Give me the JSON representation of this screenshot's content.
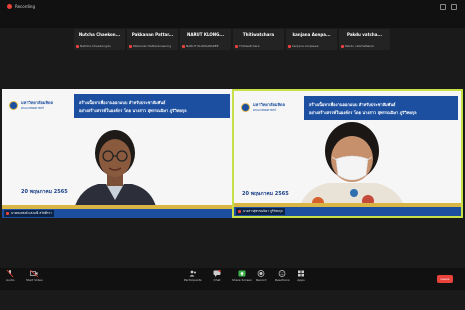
{
  "window": {
    "recording_label": "Recording"
  },
  "participants": [
    {
      "name": "Nutcha Chaekon...",
      "sub": "NatCha Chaekongdo"
    },
    {
      "name": "Pakkanan Pattar...",
      "sub": "Pakkanan Pattaranawong"
    },
    {
      "name": "NARUT KLONG...",
      "sub": "NARUT KLONGWAREE"
    },
    {
      "name": "Thitiwatchara",
      "sub": "Thitiwatchara"
    },
    {
      "name": "kanjana Aonpa...",
      "sub": "kanjana Aonpaew"
    },
    {
      "name": "Pakdu vatcha...",
      "sub": "Pakdu vatchaNakal"
    }
  ],
  "slide": {
    "university": "มหาวิทยาลัยมหิดล",
    "faculty": "คณะแพทยศาสตร์",
    "title_line1": "สร้างเนื้อหาเพื่องานออกแบบ สำหรับประชาสัมพันธ์",
    "title_line2": "อย่างสร้างสรรค์ในองค์กร โดย นางสาว สุพรรณนิษา ภูริวิทยกุล",
    "date": "20 พฤษภาคม 2565"
  },
  "tiles": [
    {
      "name": "นายกมลพงศ์ แสงมณี สวัสดิ์กว่า"
    },
    {
      "name": "นางสาวสุพรรณนิษา ภูริวิทยกุล"
    }
  ],
  "toolbar": {
    "audio": "Audio",
    "video": "Start Video",
    "participants": "Participants",
    "chat": "Chat",
    "share": "Share Screen",
    "record": "Record",
    "reactions": "Reactions",
    "apps": "Apps",
    "end": "Leave"
  },
  "colors": {
    "active_speaker": "#c8e048",
    "end": "#e8423b",
    "slide_blue": "#1c4fa0"
  }
}
